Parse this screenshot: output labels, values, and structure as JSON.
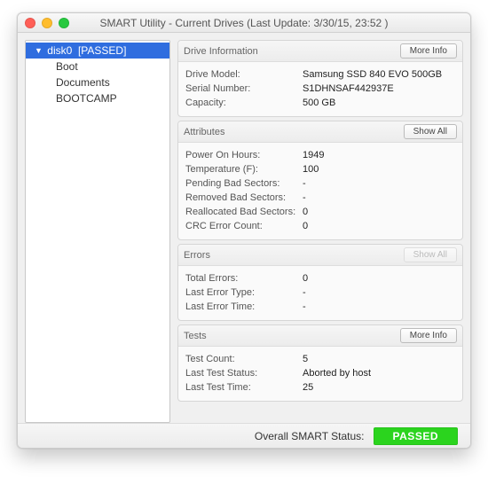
{
  "window": {
    "title": "SMART Utility - Current Drives (Last Update: 3/30/15, 23:52 )"
  },
  "sidebar": {
    "selected": {
      "icon": "▼",
      "name": "disk0",
      "status": "[PASSED]"
    },
    "children": [
      "Boot",
      "Documents",
      "BOOTCAMP"
    ]
  },
  "panels": {
    "driveInfo": {
      "title": "Drive Information",
      "button": "More Info",
      "rows": [
        {
          "k": "Drive Model:",
          "v": "Samsung SSD 840 EVO 500GB"
        },
        {
          "k": "Serial Number:",
          "v": "S1DHNSAF442937E"
        },
        {
          "k": "Capacity:",
          "v": "500 GB"
        }
      ]
    },
    "attributes": {
      "title": "Attributes",
      "button": "Show All",
      "rows": [
        {
          "k": "Power On Hours:",
          "v": "1949"
        },
        {
          "k": "Temperature (F):",
          "v": "100"
        },
        {
          "k": "Pending Bad Sectors:",
          "v": "-"
        },
        {
          "k": "Removed Bad Sectors:",
          "v": "-"
        },
        {
          "k": "Reallocated Bad Sectors:",
          "v": "0"
        },
        {
          "k": "CRC Error Count:",
          "v": "0"
        }
      ]
    },
    "errors": {
      "title": "Errors",
      "button": "Show All",
      "buttonDisabled": true,
      "rows": [
        {
          "k": "Total Errors:",
          "v": "0"
        },
        {
          "k": "Last Error Type:",
          "v": "-"
        },
        {
          "k": "Last Error Time:",
          "v": "-"
        }
      ]
    },
    "tests": {
      "title": "Tests",
      "button": "More Info",
      "rows": [
        {
          "k": "Test Count:",
          "v": "5"
        },
        {
          "k": "Last Test Status:",
          "v": "Aborted by host"
        },
        {
          "k": "Last Test Time:",
          "v": "25"
        }
      ]
    }
  },
  "footer": {
    "label": "Overall SMART Status:",
    "status": "PASSED",
    "statusColor": "#2bd41e"
  }
}
